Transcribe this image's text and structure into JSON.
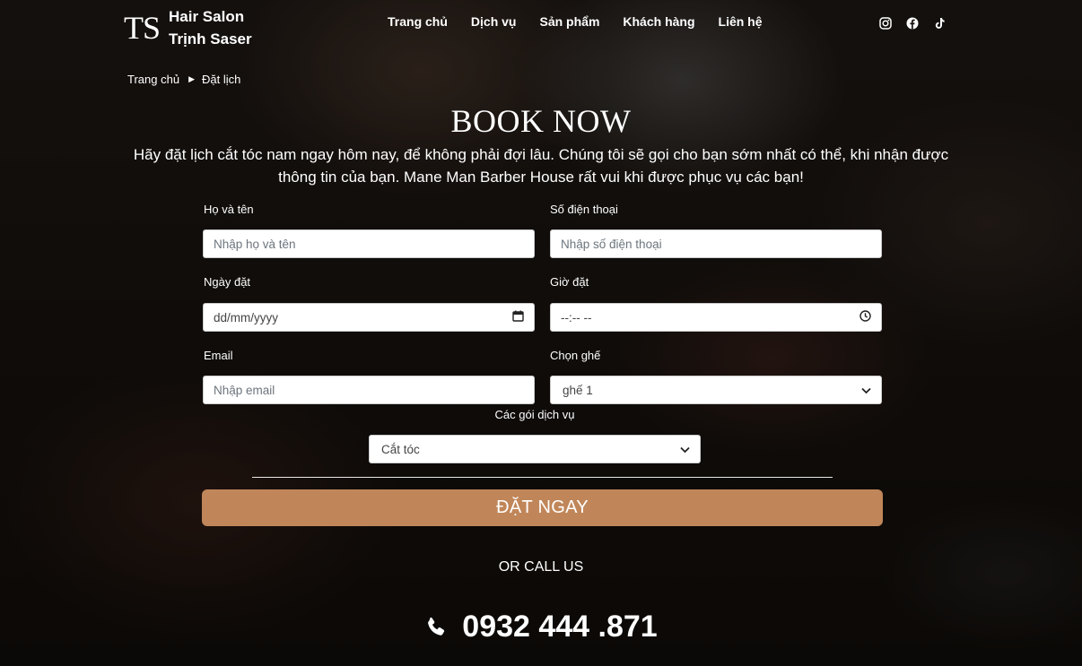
{
  "header": {
    "logo_mark": "TS",
    "logo_line1": "Hair Salon",
    "logo_line2": "Trịnh Saser",
    "nav": [
      "Trang chủ",
      "Dịch vụ",
      "Sản phẩm",
      "Khách hàng",
      "Liên hệ"
    ],
    "social_icons": [
      "instagram-icon",
      "facebook-icon",
      "tiktok-icon"
    ]
  },
  "breadcrumb": {
    "home": "Trang chủ",
    "current": "Đặt lịch"
  },
  "hero": {
    "title": "BOOK NOW",
    "intro": "Hãy đặt lịch cắt tóc nam ngay hôm nay, để không phải đợi lâu. Chúng tôi sẽ gọi cho bạn sớm nhất có thể, khi nhận được thông tin của bạn. Mane Man Barber House rất vui khi được phục vụ các bạn!"
  },
  "form": {
    "name_label": "Họ và tên",
    "name_placeholder": "Nhập họ và tên",
    "phone_label": "Số điện thoại",
    "phone_placeholder": "Nhập số điện thoại",
    "date_label": "Ngày đặt",
    "date_placeholder": "dd/mm/yyyy",
    "time_label": "Giờ đặt",
    "time_placeholder": "--:-- --",
    "email_label": "Email",
    "email_placeholder": "Nhập email",
    "chair_label": "Chọn ghế",
    "chair_value": "ghế 1",
    "service_label": "Các gói dịch vụ",
    "service_value": "Cắt tóc",
    "submit_label": "ĐẶT NGAY"
  },
  "contact": {
    "or_call": "OR CALL US",
    "phone": "0932 444 .871"
  },
  "colors": {
    "accent": "#c08659"
  }
}
